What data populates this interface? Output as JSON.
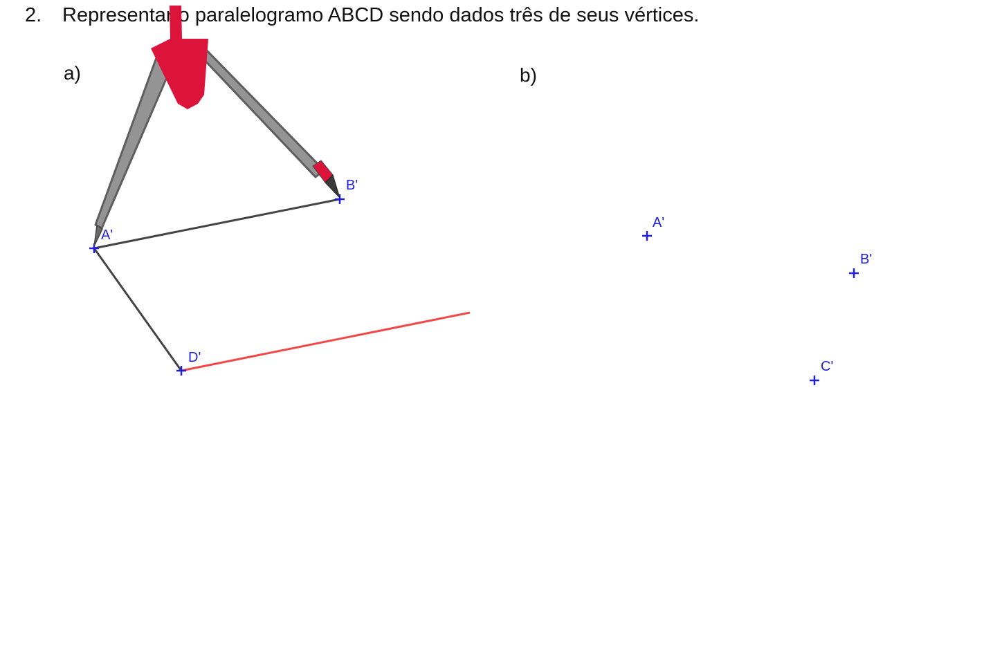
{
  "question": {
    "number": "2.",
    "text": "Representar o paralelogramo ABCD sendo dados três de seus vértices."
  },
  "parts": {
    "a": {
      "label": "a)",
      "points": {
        "A": {
          "label": "A'"
        },
        "B": {
          "label": "B'"
        },
        "D": {
          "label": "D'"
        }
      }
    },
    "b": {
      "label": "b)",
      "points": {
        "A": {
          "label": "A'"
        },
        "B": {
          "label": "B'"
        },
        "C": {
          "label": "C'"
        }
      }
    }
  },
  "tool": {
    "name": "compass-tool",
    "icon": "compass-icon"
  },
  "colors": {
    "point": "#1f1fd8",
    "segment": "#444444",
    "construction_line": "#f04848",
    "compass_body": "#8f8f8f",
    "compass_handle": "#dc143c",
    "text": "#111111"
  }
}
